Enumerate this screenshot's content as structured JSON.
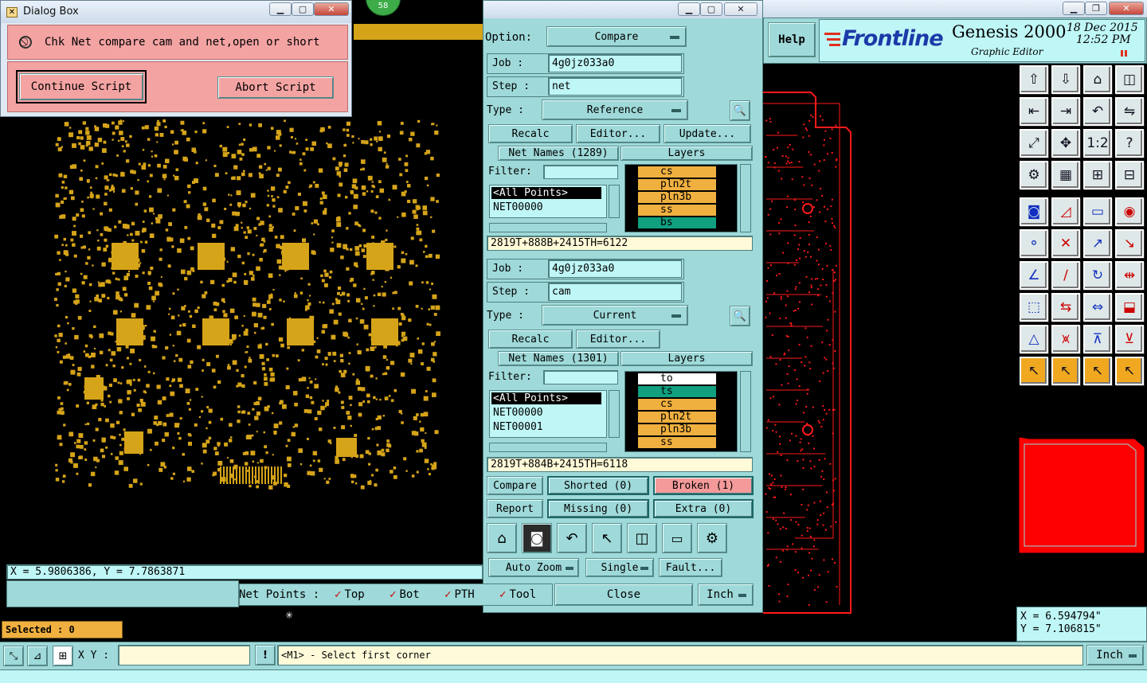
{
  "dialog": {
    "title": "Dialog Box",
    "message": "Chk Net compare cam and net,open or short",
    "continue_label": "Continue Script",
    "abort_label": "Abort Script"
  },
  "badge": "58",
  "netcompare": {
    "option_label": "Option:",
    "option_value": "Compare",
    "job_label": "Job  :",
    "step_label": "Step :",
    "type_label": "Type :",
    "filter_label": "Filter:",
    "layers_label": "Layers",
    "recalc_label": "Recalc",
    "editor_label": "Editor...",
    "update_label": "Update...",
    "ref": {
      "job": "4g0jz033a0",
      "step": "net",
      "type": "Reference",
      "net_names": "Net Names (1289)",
      "nets": [
        "<All Points>",
        "NET00000"
      ],
      "layers": [
        {
          "name": "cs",
          "color": "#f0b040"
        },
        {
          "name": "pln2t",
          "color": "#f0b040"
        },
        {
          "name": "pln3b",
          "color": "#f0b040"
        },
        {
          "name": "ss",
          "color": "#f0b040"
        },
        {
          "name": "bs",
          "color": "#10a080"
        }
      ],
      "summary": "2819T+888B+2415TH=6122"
    },
    "cur": {
      "job": "4g0jz033a0",
      "step": "cam",
      "type": "Current",
      "net_names": "Net Names (1301)",
      "nets": [
        "<All Points>",
        "NET00000",
        "NET00001"
      ],
      "layers": [
        {
          "name": "to",
          "color": "#ffffff"
        },
        {
          "name": "ts",
          "color": "#10a080"
        },
        {
          "name": "cs",
          "color": "#f0b040"
        },
        {
          "name": "pln2t",
          "color": "#f0b040"
        },
        {
          "name": "pln3b",
          "color": "#f0b040"
        },
        {
          "name": "ss",
          "color": "#f0b040"
        }
      ],
      "summary": "2819T+884B+2415TH=6118"
    },
    "compare_label": "Compare",
    "report_label": "Report",
    "shorted_label": "Shorted (0)",
    "broken_label": "Broken (1)",
    "missing_label": "Missing (0)",
    "extra_label": "Extra (0)",
    "autozoom_label": "Auto Zoom",
    "single_label": "Single",
    "fault_label": "Fault...",
    "netpoints_label": "Net Points :",
    "top_label": "Top",
    "bot_label": "Bot",
    "pth_label": "PTH",
    "tool_label": "Tool",
    "close_label": "Close",
    "unit_label": "Inch"
  },
  "header": {
    "help_label": "Help",
    "brand": "Frontline",
    "product": "Genesis 2000",
    "subtitle": "Graphic Editor",
    "date": "18 Dec 2015",
    "time": "12:52 PM"
  },
  "left_coords": "X = 5.9806386, Y = 7.7863871",
  "right_coords_x": "X =  6.594794\"",
  "right_coords_y": "Y =  7.106815\"",
  "selected": "Selected : 0",
  "status": {
    "xy_label": "X Y :",
    "xy_value": "",
    "message": "<M1> - Select first corner",
    "unit": "Inch"
  },
  "colors": {
    "panel": "#9fd9d9",
    "pcb_pad": "#d6a419",
    "pcb_trace": "#ff1a1a",
    "dialog_bg": "#f4a3a3",
    "broken": "#f49a9a"
  }
}
